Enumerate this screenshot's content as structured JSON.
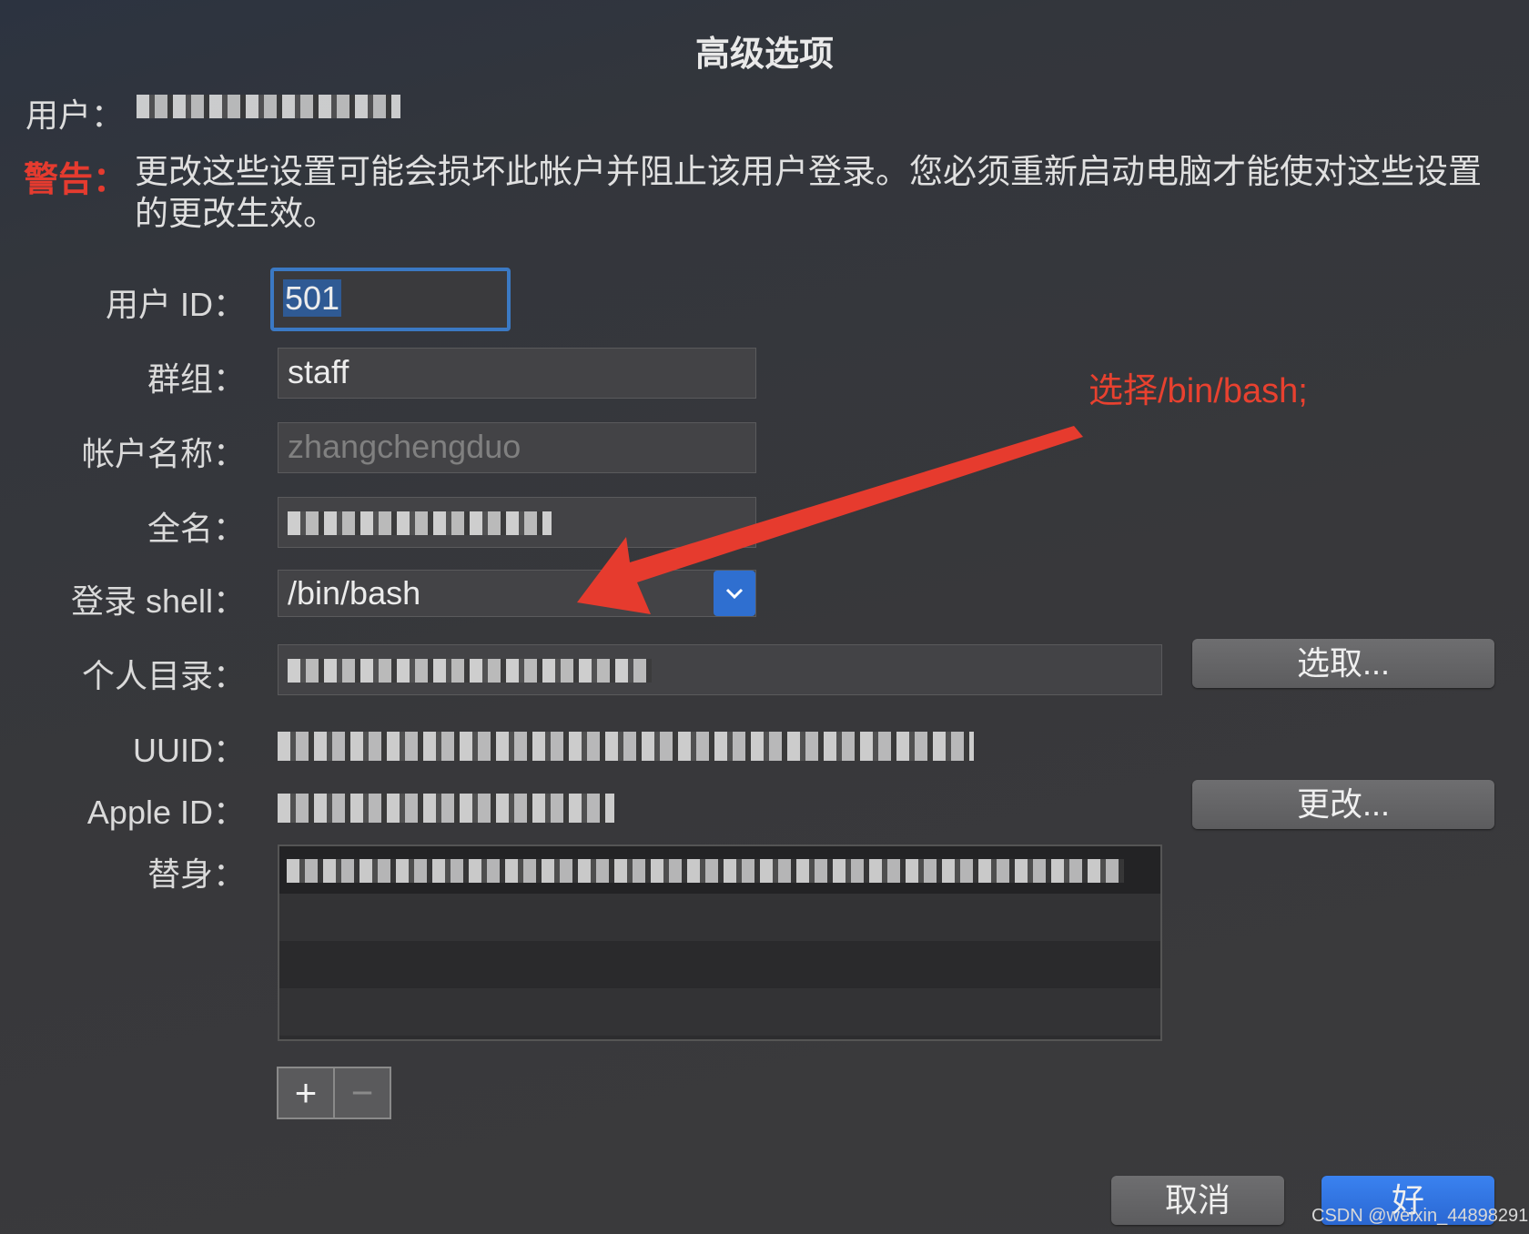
{
  "window": {
    "title": "高级选项"
  },
  "user": {
    "label": "用户："
  },
  "warning": {
    "label": "警告：",
    "text": "更改这些设置可能会损坏此帐户并阻止该用户登录。您必须重新启动电脑才能使对这些设置的更改生效。"
  },
  "fields": {
    "user_id": {
      "label": "用户 ID：",
      "value": "501"
    },
    "group": {
      "label": "群组：",
      "value": "staff"
    },
    "account_name": {
      "label": "帐户名称：",
      "value": "zhangchengduo"
    },
    "full_name": {
      "label": "全名："
    },
    "login_shell": {
      "label": "登录 shell：",
      "value": "/bin/bash"
    },
    "home_dir": {
      "label": "个人目录：",
      "choose_button": "选取..."
    },
    "uuid": {
      "label": "UUID："
    },
    "apple_id": {
      "label": "Apple ID：",
      "change_button": "更改..."
    },
    "aliases": {
      "label": "替身："
    }
  },
  "alias_controls": {
    "add": "+",
    "remove": "−"
  },
  "footer": {
    "cancel": "取消",
    "ok": "好"
  },
  "annotation": {
    "text": "选择/bin/bash;",
    "color": "#e8412f"
  },
  "watermark": {
    "text": "CSDN @weixin_44898291"
  },
  "icons": {
    "select_arrow": "chevron-down-icon",
    "annotation_arrow": "red-arrow"
  }
}
